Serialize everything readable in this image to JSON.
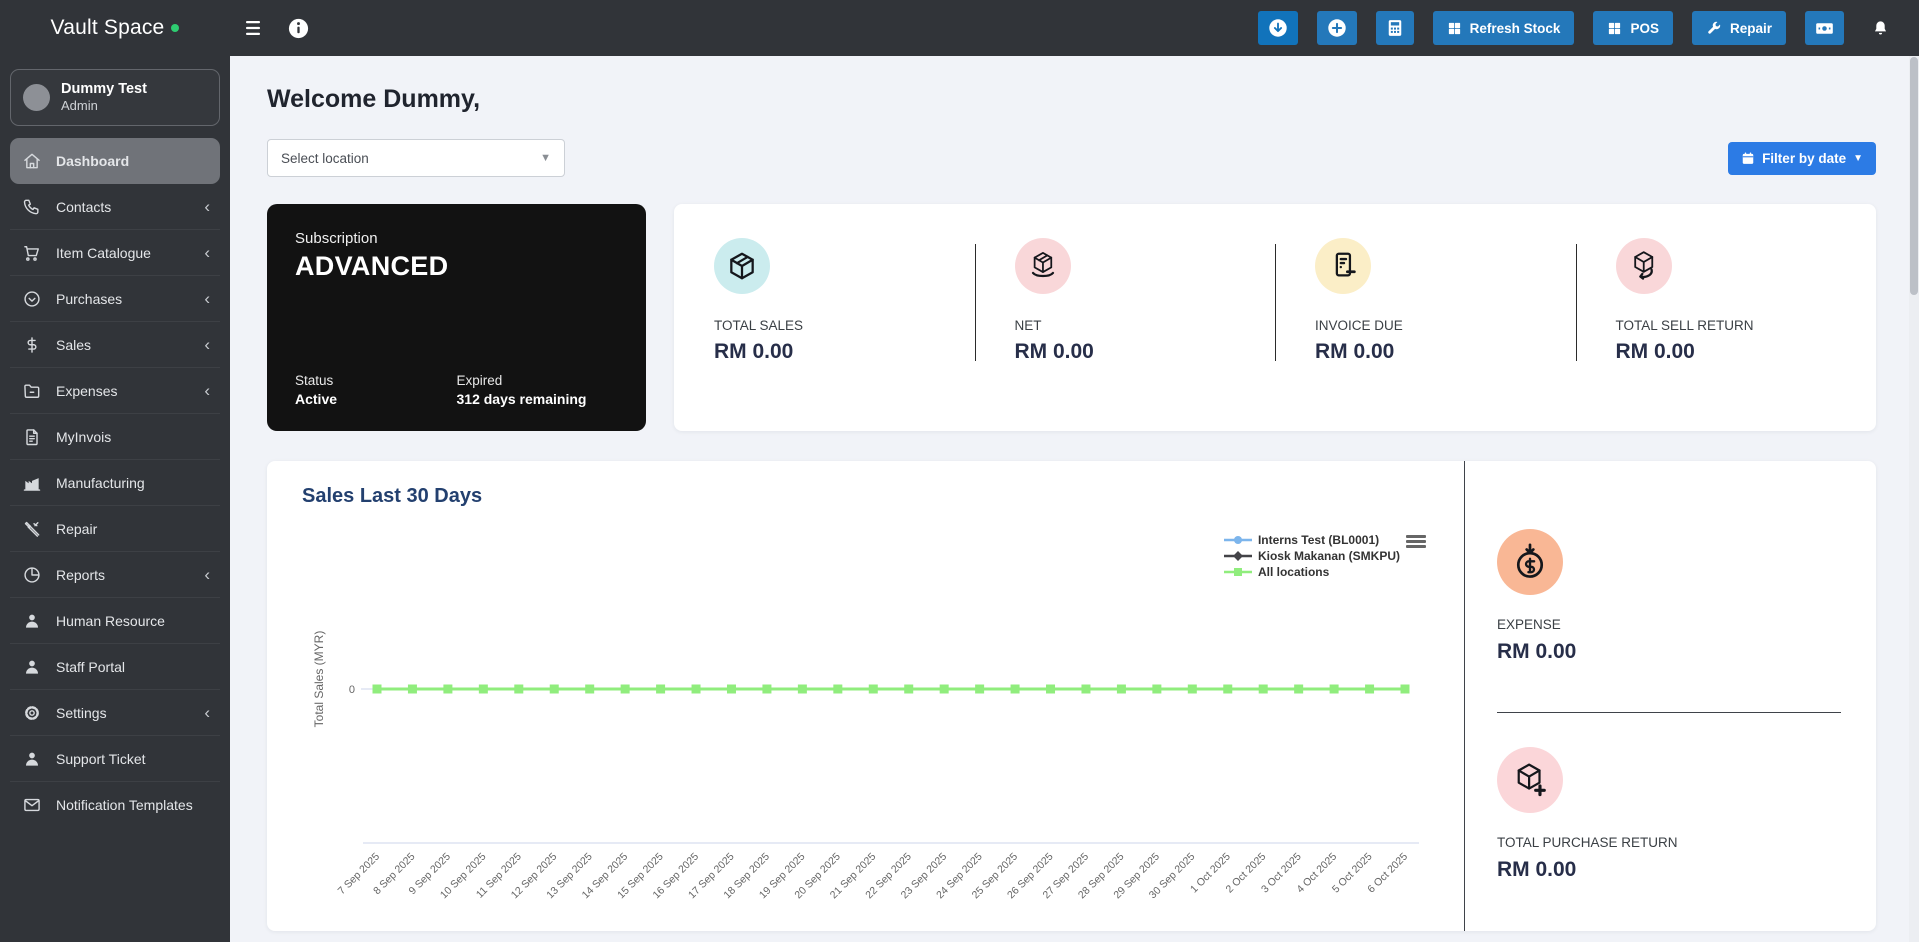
{
  "navbar": {
    "brand": "Vault Space",
    "brand_dot_color": "#2ecc71",
    "actions": [
      {
        "name": "download-button",
        "icon": "circle-down-icon",
        "label": "",
        "style": "dark-blue"
      },
      {
        "name": "add-button",
        "icon": "circle-plus-icon",
        "label": "",
        "style": ""
      },
      {
        "name": "calculator-button",
        "icon": "calculator-icon",
        "label": "",
        "style": ""
      },
      {
        "name": "refresh-stock-button",
        "icon": "grid-icon",
        "label": "Refresh Stock",
        "style": ""
      },
      {
        "name": "pos-button",
        "icon": "grid-icon",
        "label": "POS",
        "style": ""
      },
      {
        "name": "repair-button",
        "icon": "wrench-icon",
        "label": "Repair",
        "style": ""
      },
      {
        "name": "cash-button",
        "icon": "cash-icon",
        "label": "",
        "style": ""
      },
      {
        "name": "notifications-button",
        "icon": "bell-icon",
        "label": "",
        "style": "bare"
      }
    ]
  },
  "sidebar": {
    "user": {
      "name": "Dummy Test",
      "role": "Admin"
    },
    "items": [
      {
        "label": "Dashboard",
        "icon": "home-icon",
        "active": true,
        "chevron": false
      },
      {
        "label": "Contacts",
        "icon": "phone-icon",
        "active": false,
        "chevron": true
      },
      {
        "label": "Item Catalogue",
        "icon": "cart-icon",
        "active": false,
        "chevron": true
      },
      {
        "label": "Purchases",
        "icon": "badge-check-icon",
        "active": false,
        "chevron": true
      },
      {
        "label": "Sales",
        "icon": "dollar-icon",
        "active": false,
        "chevron": true
      },
      {
        "label": "Expenses",
        "icon": "folder-icon",
        "active": false,
        "chevron": true
      },
      {
        "label": "MyInvois",
        "icon": "file-invoice-icon",
        "active": false,
        "chevron": false
      },
      {
        "label": "Manufacturing",
        "icon": "factory-icon",
        "active": false,
        "chevron": false
      },
      {
        "label": "Repair",
        "icon": "tools-icon",
        "active": false,
        "chevron": false
      },
      {
        "label": "Reports",
        "icon": "chart-pie-icon",
        "active": false,
        "chevron": true
      },
      {
        "label": "Human Resource",
        "icon": "user-icon",
        "active": false,
        "chevron": false
      },
      {
        "label": "Staff Portal",
        "icon": "user-icon",
        "active": false,
        "chevron": false
      },
      {
        "label": "Settings",
        "icon": "gear-icon",
        "active": false,
        "chevron": true
      },
      {
        "label": "Support Ticket",
        "icon": "user-icon",
        "active": false,
        "chevron": false
      },
      {
        "label": "Notification Templates",
        "icon": "mail-icon",
        "active": false,
        "chevron": false
      }
    ]
  },
  "main": {
    "welcome": "Welcome Dummy,",
    "location_placeholder": "Select location",
    "filter_button": "Filter by date",
    "subscription": {
      "label": "Subscription",
      "plan": "ADVANCED",
      "status_label": "Status",
      "status_value": "Active",
      "expiry_label": "Expired",
      "expiry_value": "312 days remaining"
    },
    "stats": [
      {
        "label": "TOTAL SALES",
        "value": "RM 0.00",
        "icon": "package-icon",
        "circle": "#cbecee"
      },
      {
        "label": "NET",
        "value": "RM 0.00",
        "icon": "package-net-icon",
        "circle": "#f9d7d9"
      },
      {
        "label": "INVOICE DUE",
        "value": "RM 0.00",
        "icon": "invoice-icon",
        "circle": "#fbeec7"
      },
      {
        "label": "TOTAL SELL RETURN",
        "value": "RM 0.00",
        "icon": "package-return-icon",
        "circle": "#f9d7d9"
      }
    ],
    "side_stats": [
      {
        "label": "EXPENSE",
        "value": "RM 0.00",
        "icon": "expense-icon",
        "circle": "#f9b795"
      },
      {
        "label": "TOTAL PURCHASE RETURN",
        "value": "RM 0.00",
        "icon": "package-plus-icon",
        "circle": "#fbd6d9"
      }
    ]
  },
  "chart_data": {
    "type": "line",
    "title": "Sales Last 30 Days",
    "xlabel": "",
    "ylabel": "Total Sales (MYR)",
    "ylim": [
      -1,
      1
    ],
    "visible_y_ticks": [
      "0"
    ],
    "grid": false,
    "legend_position": "top-right",
    "categories": [
      "7 Sep 2025",
      "8 Sep 2025",
      "9 Sep 2025",
      "10 Sep 2025",
      "11 Sep 2025",
      "12 Sep 2025",
      "13 Sep 2025",
      "14 Sep 2025",
      "15 Sep 2025",
      "16 Sep 2025",
      "17 Sep 2025",
      "18 Sep 2025",
      "19 Sep 2025",
      "20 Sep 2025",
      "21 Sep 2025",
      "22 Sep 2025",
      "23 Sep 2025",
      "24 Sep 2025",
      "25 Sep 2025",
      "26 Sep 2025",
      "27 Sep 2025",
      "28 Sep 2025",
      "29 Sep 2025",
      "30 Sep 2025",
      "1 Oct 2025",
      "2 Oct 2025",
      "3 Oct 2025",
      "4 Oct 2025",
      "5 Oct 2025",
      "6 Oct 2025"
    ],
    "series": [
      {
        "name": "Interns Test (BL0001)",
        "color": "#7cb5ec",
        "marker": "circle",
        "values": [
          0,
          0,
          0,
          0,
          0,
          0,
          0,
          0,
          0,
          0,
          0,
          0,
          0,
          0,
          0,
          0,
          0,
          0,
          0,
          0,
          0,
          0,
          0,
          0,
          0,
          0,
          0,
          0,
          0,
          0
        ]
      },
      {
        "name": "Kiosk Makanan (SMKPU)",
        "color": "#434348",
        "marker": "diamond",
        "values": [
          0,
          0,
          0,
          0,
          0,
          0,
          0,
          0,
          0,
          0,
          0,
          0,
          0,
          0,
          0,
          0,
          0,
          0,
          0,
          0,
          0,
          0,
          0,
          0,
          0,
          0,
          0,
          0,
          0,
          0
        ]
      },
      {
        "name": "All locations",
        "color": "#90ed7d",
        "marker": "square",
        "values": [
          0,
          0,
          0,
          0,
          0,
          0,
          0,
          0,
          0,
          0,
          0,
          0,
          0,
          0,
          0,
          0,
          0,
          0,
          0,
          0,
          0,
          0,
          0,
          0,
          0,
          0,
          0,
          0,
          0,
          0
        ]
      }
    ]
  }
}
